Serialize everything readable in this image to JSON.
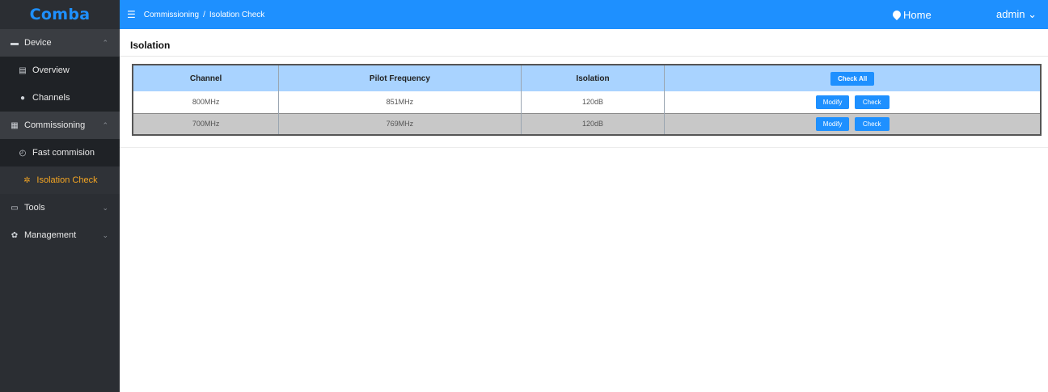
{
  "app": {
    "logo": "Comba"
  },
  "sidebar": {
    "items": [
      {
        "label": "Device",
        "icon": "monitor-icon",
        "chevron": "^"
      },
      {
        "label": "Overview",
        "icon": "list-icon"
      },
      {
        "label": "Channels",
        "icon": "dot-icon"
      },
      {
        "label": "Commissioning",
        "icon": "grid-icon",
        "chevron": "^"
      },
      {
        "label": "Fast commision",
        "icon": "gauge-icon"
      },
      {
        "label": "Isolation Check",
        "icon": "wrench-icon",
        "active": true
      },
      {
        "label": "Tools",
        "icon": "tools-icon",
        "chevron": "v"
      },
      {
        "label": "Management",
        "icon": "gear-icon",
        "chevron": "v"
      }
    ]
  },
  "topbar": {
    "breadcrumb": [
      "Commissioning",
      "Isolation Check"
    ],
    "separator": "/",
    "home_label": "Home",
    "user_label": "admin"
  },
  "main": {
    "section_title": "Isolation",
    "table": {
      "headers": [
        "Channel",
        "Pilot Frequency",
        "Isolation"
      ],
      "check_all_label": "Check All",
      "rows": [
        {
          "channel": "800MHz",
          "pilot_frequency": "851MHz",
          "isolation": "120dB"
        },
        {
          "channel": "700MHz",
          "pilot_frequency": "769MHz",
          "isolation": "120dB"
        }
      ],
      "modify_label": "Modify",
      "check_label": "Check"
    }
  },
  "colors": {
    "accent": "#1e90ff",
    "sidebar_bg": "#2b2e33",
    "active_item": "#f5a623",
    "header_bg": "#a9d3ff"
  }
}
